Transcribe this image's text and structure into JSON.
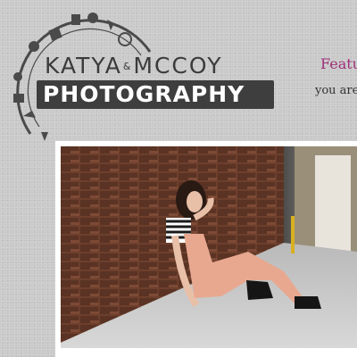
{
  "logo": {
    "name_first": "KATYA",
    "ampersand": "&",
    "name_last": "MCCOY",
    "subtitle": "PHOTOGRAPHY"
  },
  "header": {
    "featured_text": "Featu",
    "tagline_text": "you are"
  },
  "hero": {
    "photo_icon": "photo-image"
  },
  "colors": {
    "accent": "#a0307a",
    "logo_dark": "#3e3e3e",
    "background": "#c9c9c9"
  }
}
